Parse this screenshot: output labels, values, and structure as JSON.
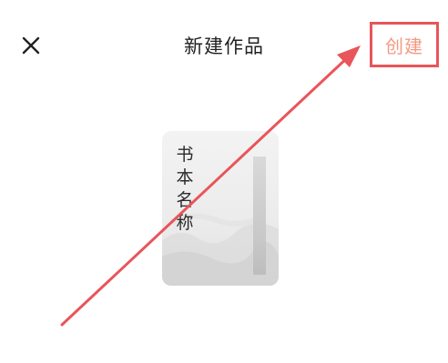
{
  "header": {
    "close_icon": "close-icon",
    "title": "新建作品",
    "create_label": "创建"
  },
  "cover": {
    "title": "书本名称"
  },
  "colors": {
    "accent": "#f39a82",
    "highlight": "#e8555a",
    "title_text": "#222222"
  }
}
